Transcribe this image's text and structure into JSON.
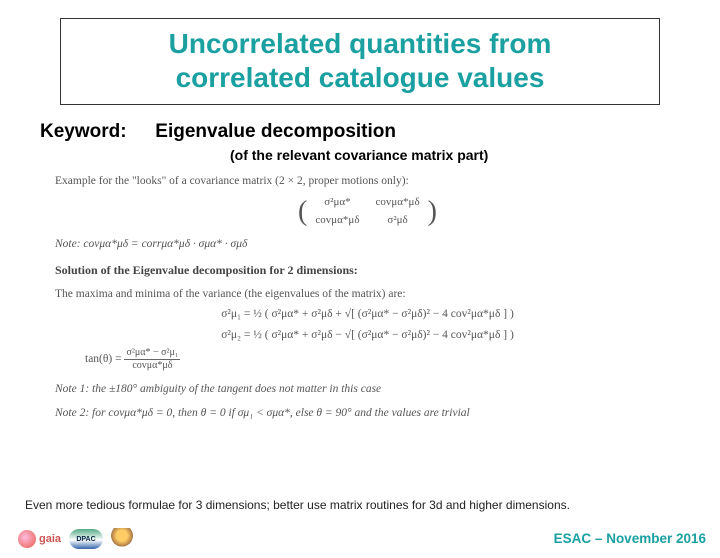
{
  "title": {
    "line1": "Uncorrelated quantities from",
    "line2": "correlated catalogue values"
  },
  "keyword": {
    "label": "Keyword:",
    "value": "Eigenvalue decomposition",
    "sub": "(of the relevant covariance matrix part)"
  },
  "math": {
    "example_label": "Example for the \"looks\" of a covariance matrix (2 × 2, proper motions only):",
    "m11": "σ²μα*",
    "m12": "covμα*μδ",
    "m21": "covμα*μδ",
    "m22": "σ²μδ",
    "note_cov": "Note: covμα*μδ = corrμα*μδ · σμα* · σμδ",
    "solution_heading": "Solution of the Eigenvalue decomposition for 2 dimensions:",
    "solution_sub": "The maxima and minima of the variance (the eigenvalues of the matrix) are:",
    "eq1_lhs": "σ²μ₁ =",
    "eq1_rhs": "½ ( σ²μα* + σ²μδ + √[ (σ²μα* − σ²μδ)² − 4 cov²μα*μδ ] )",
    "eq2_lhs": "σ²μ₂ =",
    "eq2_rhs": "½ ( σ²μα* + σ²μδ − √[ (σ²μα* − σ²μδ)² − 4 cov²μα*μδ ] )",
    "eq3_lhs": "tan(θ) =",
    "eq3_num": "σ²μα* − σ²μ₁",
    "eq3_den": "covμα*μδ",
    "note1": "Note 1: the ±180° ambiguity of the tangent does not matter in this case",
    "note2": "Note 2: for covμα*μδ = 0, then θ = 0 if σμ₁ < σμα*, else θ = 90° and the values are trivial"
  },
  "bottom_note": "Even more tedious formulae for 3 dimensions; better use matrix routines for 3d and higher dimensions.",
  "footer": {
    "gaia_text": "gaia",
    "dpac_text": "DPAC",
    "right": "ESAC – November 2016"
  }
}
